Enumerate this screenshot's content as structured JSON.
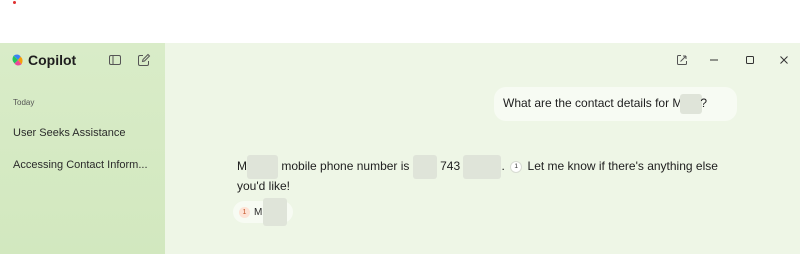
{
  "app": {
    "name": "Copilot",
    "accent": "#e03030"
  },
  "sidebar": {
    "section_label": "Today",
    "conversations": [
      {
        "title": "User Seeks Assistance"
      },
      {
        "title": "Accessing Contact Inform..."
      }
    ],
    "icons": [
      "sidebar-toggle-icon",
      "new-chat-icon"
    ]
  },
  "window_controls": {
    "icons": [
      "popout-icon",
      "minimize-icon",
      "maximize-icon",
      "close-icon"
    ]
  },
  "chat": {
    "user_message": {
      "prefix": "What are the contact details for M",
      "suffix": "?"
    },
    "assistant_message": {
      "part1": "M",
      "part2": "mobile phone number is",
      "part3": "743",
      "part4": ".",
      "citation_number": "1",
      "part5": "Let me know if there's anything else you'd like!"
    },
    "source": {
      "number": "1",
      "label": "M"
    }
  }
}
